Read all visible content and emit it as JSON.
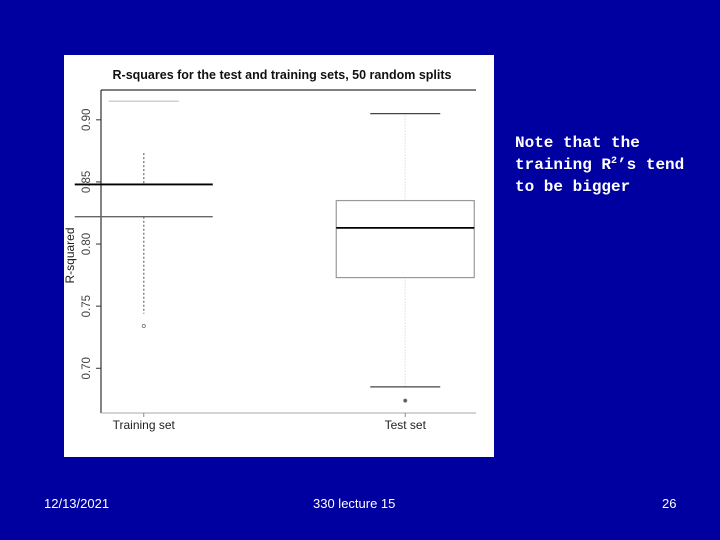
{
  "slide": {
    "background_color": "#0000a0",
    "note": {
      "line1": "Note that the",
      "line2_pre": "training R",
      "line2_sup": "2",
      "line2_post": "’s tend",
      "line3": "to be bigger"
    },
    "footer": {
      "date": "12/13/2021",
      "title": "330 lecture 15",
      "page": "26"
    }
  },
  "chart_data": {
    "type": "boxplot",
    "title": "R-squares for the test and training sets, 50 random splits",
    "xlabel": "",
    "ylabel": "R-squared",
    "ylim": [
      0.664,
      0.924
    ],
    "yticks": [
      0.7,
      0.75,
      0.8,
      0.85,
      0.9
    ],
    "ytick_labels": [
      "0.70",
      "0.75",
      "0.80",
      "0.85",
      "0.90"
    ],
    "categories": [
      "Training set",
      "Test set"
    ],
    "grid": false,
    "series": [
      {
        "name": "Training set",
        "whisker_low": 0.744,
        "q1": 0.822,
        "median": 0.848,
        "q3": 0.849,
        "whisker_high": 0.874,
        "cap_high": 0.915,
        "outliers": [
          0.734
        ]
      },
      {
        "name": "Test set",
        "whisker_low": 0.685,
        "q1": 0.773,
        "median": 0.813,
        "q3": 0.835,
        "whisker_high": 0.905,
        "outliers": [
          0.674
        ]
      }
    ]
  }
}
